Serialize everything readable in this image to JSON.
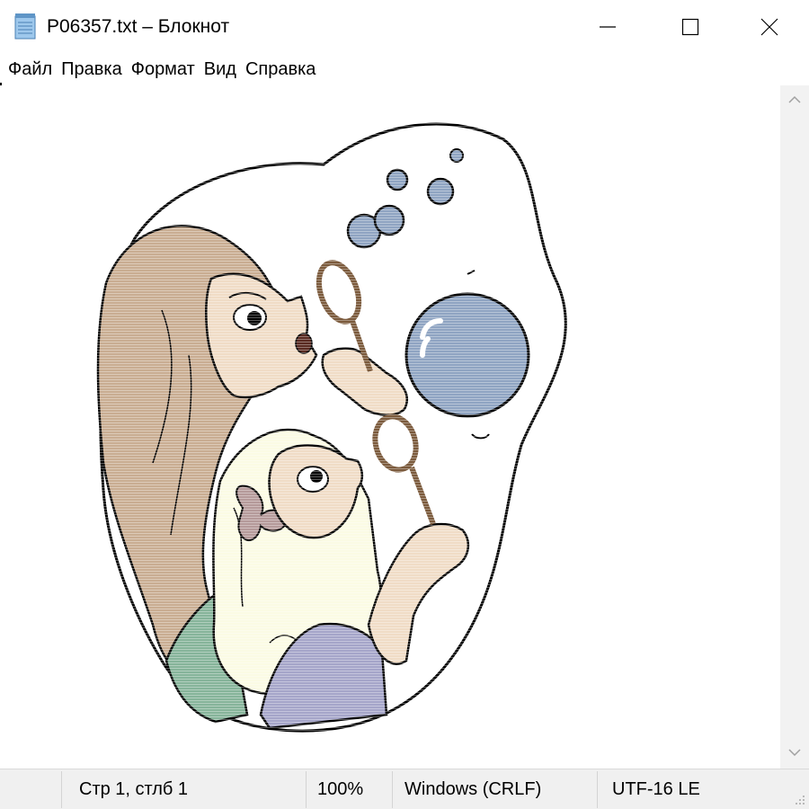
{
  "window": {
    "title": "P06357.txt – Блокнот",
    "icon": "notepad-icon"
  },
  "window_controls": {
    "minimize_icon": "minimize-icon",
    "maximize_icon": "maximize-icon",
    "close_icon": "close-icon"
  },
  "menu": {
    "items": [
      {
        "label": "Файл"
      },
      {
        "label": "Правка"
      },
      {
        "label": "Формат"
      },
      {
        "label": "Вид"
      },
      {
        "label": "Справка"
      }
    ]
  },
  "document": {
    "content_type": "clip-art: woman and girl blowing soap bubbles",
    "colors": {
      "hair_woman": "#c9ad92",
      "skin": "#f0dcc6",
      "hair_girl": "#fbfbe4",
      "bubble": "#8fa4c2",
      "dress_green": "#86b49a",
      "dress_purple": "#a5a5c9",
      "outline": "#000000"
    }
  },
  "status": {
    "position": "Стр 1, стлб 1",
    "zoom": "100%",
    "line_endings": "Windows (CRLF)",
    "encoding": "UTF-16 LE"
  }
}
